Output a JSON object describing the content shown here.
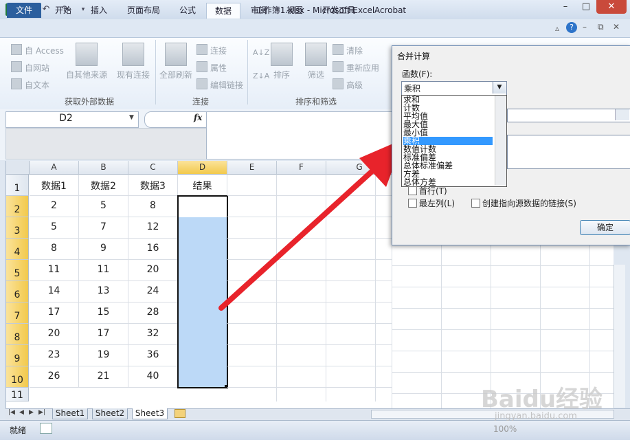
{
  "window": {
    "title": "工作簿1.xlsx - Microsoft Excel",
    "app_icon": "X",
    "colors": {
      "ribbon": "#dfe8f3",
      "file_tab": "#2b5f9e",
      "selection": "#bcd9f7",
      "header_highlight": "#f2c94c",
      "arrow": "#e8232b"
    }
  },
  "tabs": [
    "文件",
    "开始",
    "插入",
    "页面布局",
    "公式",
    "数据",
    "审阅",
    "视图",
    "开发工具",
    "Acrobat"
  ],
  "ribbon": {
    "get_external": {
      "access": "自 Access",
      "web": "自网站",
      "text": "自文本",
      "other": "自其他来源",
      "existing": "现有连接",
      "label": "获取外部数据"
    },
    "connections": {
      "refresh_all": "全部刷新",
      "connections": "连接",
      "properties": "属性",
      "edit_links": "编辑链接",
      "label": "连接"
    },
    "sort_filter": {
      "sort": "排序",
      "filter": "筛选",
      "clear": "清除",
      "reapply": "重新应用",
      "advanced": "高级",
      "label": "排序和筛选"
    }
  },
  "formula_bar": {
    "name_box": "D2",
    "fx": "fx"
  },
  "grid": {
    "columns": [
      "A",
      "B",
      "C",
      "D",
      "E",
      "F",
      "G"
    ],
    "rows": [
      "1",
      "2",
      "3",
      "4",
      "5",
      "6",
      "7",
      "8",
      "9",
      "10",
      "11"
    ],
    "headers": [
      "数据1",
      "数据2",
      "数据3",
      "结果"
    ],
    "data": [
      [
        "2",
        "5",
        "8"
      ],
      [
        "5",
        "7",
        "12"
      ],
      [
        "8",
        "9",
        "16"
      ],
      [
        "11",
        "11",
        "20"
      ],
      [
        "14",
        "13",
        "24"
      ],
      [
        "17",
        "15",
        "28"
      ],
      [
        "20",
        "17",
        "32"
      ],
      [
        "23",
        "19",
        "36"
      ],
      [
        "26",
        "21",
        "40"
      ]
    ]
  },
  "sheets": [
    "Sheet1",
    "Sheet2",
    "Sheet3"
  ],
  "status": {
    "ready": "就绪",
    "zoom": "100%"
  },
  "dialog": {
    "title": "合并计算",
    "function_label": "函数(F):",
    "selected": "乘积",
    "options": [
      "求和",
      "计数",
      "平均值",
      "最大值",
      "最小值",
      "乘积",
      "数值计数",
      "标准偏差",
      "总体标准偏差",
      "方差",
      "总体方差"
    ],
    "highlighted_index": 5,
    "top_row": "首行(T)",
    "left_col": "最左列(L)",
    "create_links": "创建指向源数据的链接(S)",
    "ok": "确定"
  },
  "watermark": {
    "brand": "Baidu经验",
    "url": "jingyan.baidu.com"
  }
}
